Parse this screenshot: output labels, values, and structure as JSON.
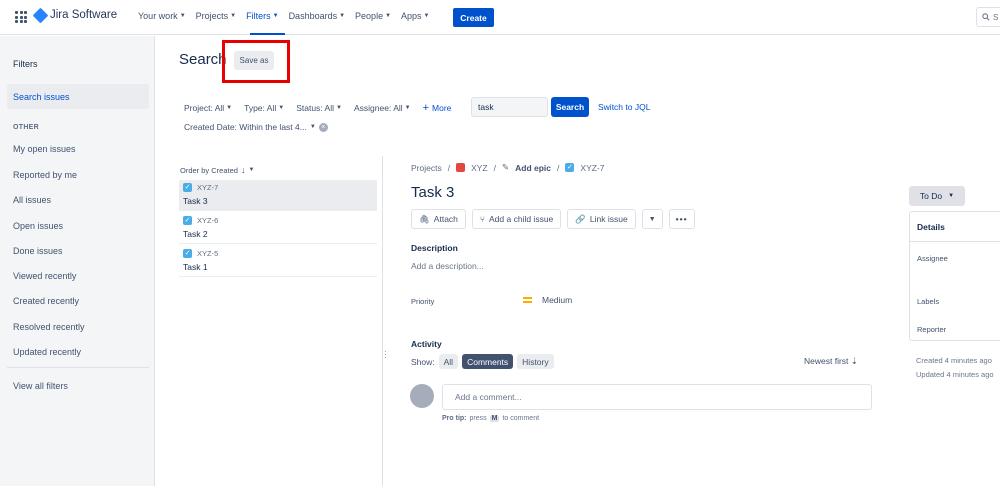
{
  "app": {
    "name": "Jira Software"
  },
  "nav": {
    "your_work": "Your work",
    "projects": "Projects",
    "filters": "Filters",
    "dashboards": "Dashboards",
    "people": "People",
    "apps": "Apps",
    "create": "Create",
    "search_placeholder": "S"
  },
  "sidebar": {
    "title": "Filters",
    "search_issues": "Search issues",
    "other_heading": "OTHER",
    "items": [
      "My open issues",
      "Reported by me",
      "All issues",
      "Open issues",
      "Done issues",
      "Viewed recently",
      "Created recently",
      "Resolved recently",
      "Updated recently"
    ],
    "view_all": "View all filters"
  },
  "header": {
    "title": "Search",
    "save_as": "Save as"
  },
  "filters": {
    "project": "Project: All",
    "type": "Type: All",
    "status": "Status: All",
    "assignee": "Assignee: All",
    "more": "More",
    "text_value": "task",
    "search": "Search",
    "switch_jql": "Switch to JQL",
    "created_date": "Created Date: Within the last 4..."
  },
  "list": {
    "order_by": "Order by Created",
    "issues": [
      {
        "key": "XYZ-7",
        "summary": "Task 3"
      },
      {
        "key": "XYZ-6",
        "summary": "Task 2"
      },
      {
        "key": "XYZ-5",
        "summary": "Task 1"
      }
    ]
  },
  "detail": {
    "crumb_projects": "Projects",
    "crumb_project": "XYZ",
    "crumb_epic": "Add epic",
    "crumb_key": "XYZ-7",
    "title": "Task 3",
    "attach": "Attach",
    "add_child": "Add a child issue",
    "link_issue": "Link issue",
    "description_label": "Description",
    "description_placeholder": "Add a description...",
    "priority_label": "Priority",
    "priority_value": "Medium",
    "activity_label": "Activity",
    "show_label": "Show:",
    "tab_all": "All",
    "tab_comments": "Comments",
    "tab_history": "History",
    "newest_first": "Newest first",
    "comment_placeholder": "Add a comment...",
    "protip_label": "Pro tip:",
    "protip_press": "press",
    "protip_key": "M",
    "protip_rest": "to comment"
  },
  "panel": {
    "status": "To Do",
    "details": "Details",
    "assignee": "Assignee",
    "labels": "Labels",
    "reporter": "Reporter",
    "created": "Created 4 minutes ago",
    "updated": "Updated 4 minutes ago"
  },
  "colors": {
    "brand": "#0052cc",
    "highlight": "#e60000",
    "priority": "#ffab00"
  }
}
